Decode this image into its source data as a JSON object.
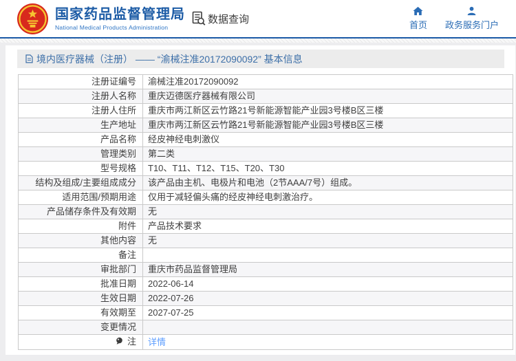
{
  "header": {
    "title": "国家药品监督管理局",
    "subtitle": "National Medical Products Administration",
    "data_query_label": "数据查询",
    "nav": {
      "home": "首页",
      "portal": "政务服务门户"
    }
  },
  "breadcrumb": {
    "text": "境内医疗器械（注册） —— “渝械注准20172090092” 基本信息"
  },
  "table": {
    "rows": [
      {
        "label": "注册证编号",
        "value": "渝械注准20172090092"
      },
      {
        "label": "注册人名称",
        "value": "重庆迈德医疗器械有限公司"
      },
      {
        "label": "注册人住所",
        "value": "重庆市两江新区云竹路21号新能源智能产业园3号楼B区三楼"
      },
      {
        "label": "生产地址",
        "value": "重庆市两江新区云竹路21号新能源智能产业园3号楼B区三楼"
      },
      {
        "label": "产品名称",
        "value": "经皮神经电刺激仪"
      },
      {
        "label": "管理类别",
        "value": "第二类"
      },
      {
        "label": "型号规格",
        "value": "T10、T11、T12、T15、T20、T30"
      },
      {
        "label": "结构及组成/主要组成成分",
        "value": "该产品由主机、电极片和电池（2节AAA/7号）组成。"
      },
      {
        "label": "适用范围/预期用途",
        "value": "仅用于减轻偏头痛的经皮神经电刺激治疗。"
      },
      {
        "label": "产品储存条件及有效期",
        "value": "无"
      },
      {
        "label": "附件",
        "value": "产品技术要求"
      },
      {
        "label": "其他内容",
        "value": "无"
      },
      {
        "label": "备注",
        "value": ""
      },
      {
        "label": "审批部门",
        "value": "重庆市药品监督管理局"
      },
      {
        "label": "批准日期",
        "value": "2022-06-14"
      },
      {
        "label": "生效日期",
        "value": "2022-07-26"
      },
      {
        "label": "有效期至",
        "value": "2027-07-25"
      },
      {
        "label": "变更情况",
        "value": ""
      },
      {
        "label": "注",
        "value": "详情",
        "value_is_link": true
      }
    ]
  },
  "icons": {
    "emblem": "china-national-emblem",
    "data_query": "document-search-icon",
    "home": "home-icon",
    "portal": "person-icon",
    "breadcrumb": "document-icon",
    "note": "note-balloon-icon"
  },
  "colors": {
    "brand_blue": "#1d5ca6",
    "nav_blue": "#2a6cb5",
    "breadcrumb_blue": "#3d6fa8",
    "link_blue": "#5e9eff",
    "header_rule": "#1b5aa7",
    "table_border": "#c9c9c9",
    "row_alt_bg": "#f6f6f8",
    "titlebar_bg": "#ececec",
    "page_bg": "#ededef",
    "text": "#3f3f3f",
    "emblem_red": "#d8291d",
    "emblem_gold": "#f6c431"
  }
}
